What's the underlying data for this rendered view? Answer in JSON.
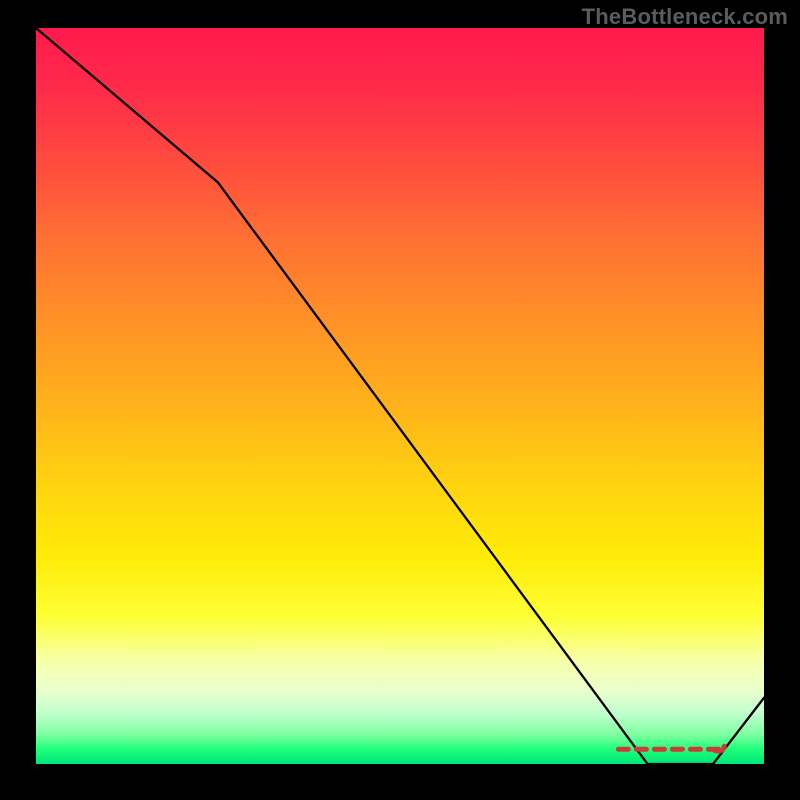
{
  "watermark": "TheBottleneck.com",
  "colors": {
    "page_bg": "#000000",
    "watermark_text": "#5c5c5c"
  },
  "chart_data": {
    "type": "line",
    "title": "",
    "xlabel": "",
    "ylabel": "",
    "ylim": [
      0,
      100
    ],
    "xlim": [
      0,
      100
    ],
    "series": [
      {
        "name": "curve",
        "x": [
          0,
          25,
          84,
          93,
          100
        ],
        "y": [
          100,
          79,
          0,
          0,
          9
        ]
      }
    ],
    "markers": {
      "name": "dashed-flat-segment",
      "color": "#cc3a3a",
      "points": [
        {
          "x": 80,
          "y": 2
        },
        {
          "x": 94,
          "y": 2
        }
      ]
    }
  }
}
